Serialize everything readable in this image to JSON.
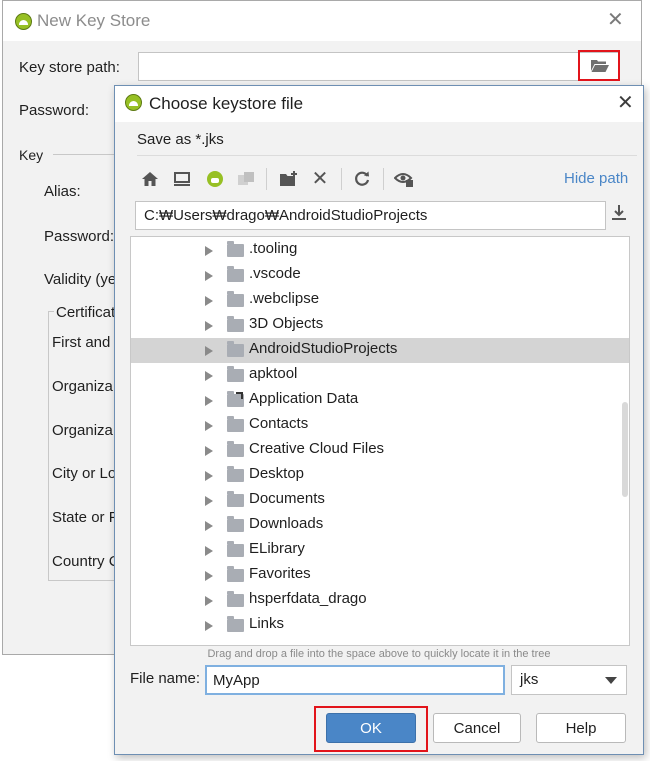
{
  "background_dialog": {
    "title": "New Key Store",
    "key_store_path_label": "Key store path:",
    "password_label": "Password:",
    "key_section_label": "Key",
    "alias_label": "Alias:",
    "key_password_label": "Password:",
    "validity_label": "Validity (ye",
    "certificate_label": "Certificat",
    "first_last_label": "First and",
    "org_unit_label": "Organiza",
    "org_label": "Organiza",
    "city_label": "City or Lo",
    "state_label": "State or P",
    "country_label": "Country C"
  },
  "chooser": {
    "title": "Choose keystore file",
    "save_as": "Save as *.jks",
    "hide_path": "Hide path",
    "path": "C:₩Users₩drago₩AndroidStudioProjects",
    "tree_items": [
      {
        "label": ".tooling",
        "selected": false
      },
      {
        "label": ".vscode",
        "selected": false
      },
      {
        "label": ".webclipse",
        "selected": false
      },
      {
        "label": "3D Objects",
        "selected": false
      },
      {
        "label": "AndroidStudioProjects",
        "selected": true
      },
      {
        "label": "apktool",
        "selected": false
      },
      {
        "label": "Application Data",
        "selected": false,
        "link": true
      },
      {
        "label": "Contacts",
        "selected": false
      },
      {
        "label": "Creative Cloud Files",
        "selected": false
      },
      {
        "label": "Desktop",
        "selected": false
      },
      {
        "label": "Documents",
        "selected": false
      },
      {
        "label": "Downloads",
        "selected": false
      },
      {
        "label": "ELibrary",
        "selected": false
      },
      {
        "label": "Favorites",
        "selected": false
      },
      {
        "label": "hsperfdata_drago",
        "selected": false
      },
      {
        "label": "Links",
        "selected": false
      }
    ],
    "drag_hint": "Drag and drop a file into the space above to quickly locate it in the tree",
    "file_name_label": "File name:",
    "file_name_value": "MyApp",
    "extension": "jks",
    "ok_label": "OK",
    "cancel_label": "Cancel",
    "help_label": "Help"
  },
  "colors": {
    "accent": "#4a86c7",
    "highlight": "#e2141b",
    "selection": "#d4d4d4"
  }
}
